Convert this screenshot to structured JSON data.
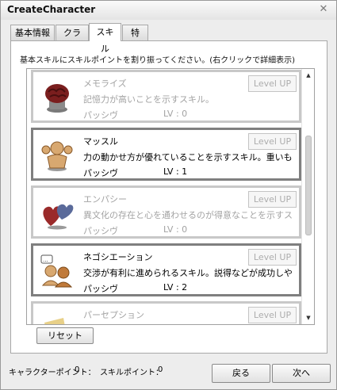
{
  "window": {
    "title": "CreateCharacter",
    "close_label": "✕"
  },
  "tabs": [
    {
      "label": "基本情報"
    },
    {
      "label": "クラス"
    },
    {
      "label": "スキル"
    },
    {
      "label": "特性"
    }
  ],
  "active_tab": "スキル",
  "instruction": "基本スキルにスキルポイントを割り振ってください。(右クリックで詳細表示)",
  "skills": [
    {
      "name": "メモライズ",
      "description": "記憶力が高いことを示すスキル。",
      "type": "パッシヴ",
      "level_text": "LV : 0",
      "button": "Level UP",
      "icon": "brain-icon"
    },
    {
      "name": "マッスル",
      "description": "力の動かせ方が優れていることを示すスキル。重いも",
      "type": "パッシヴ",
      "level_text": "LV : 1",
      "button": "Level UP",
      "icon": "muscle-person-icon"
    },
    {
      "name": "エンパシー",
      "description": "異文化の存在と心を通わせるのが得意なことを示すス",
      "type": "パッシヴ",
      "level_text": "LV : 0",
      "button": "Level UP",
      "icon": "hearts-icon"
    },
    {
      "name": "ネゴシエーション",
      "description": "交渉が有利に進められるスキル。説得などが成功しや",
      "type": "パッシヴ",
      "level_text": "LV : 2",
      "button": "Level UP",
      "icon": "negotiation-icon"
    },
    {
      "name": "パーセプション",
      "description": "",
      "type": "",
      "level_text": "",
      "button": "Level UP",
      "icon": "perception-icon"
    }
  ],
  "reset_label": "リセット",
  "footer": {
    "character_points_label": "キャラクターポイント：",
    "character_points_value": "0",
    "skill_points_label": "スキルポイント：",
    "skill_points_value": "0"
  },
  "back_label": "戻る",
  "next_label": "次へ",
  "colors": {
    "active_border": "#7f7f7f",
    "dim_border": "#c8c8c8",
    "disabled_text": "#a3a3a3"
  }
}
